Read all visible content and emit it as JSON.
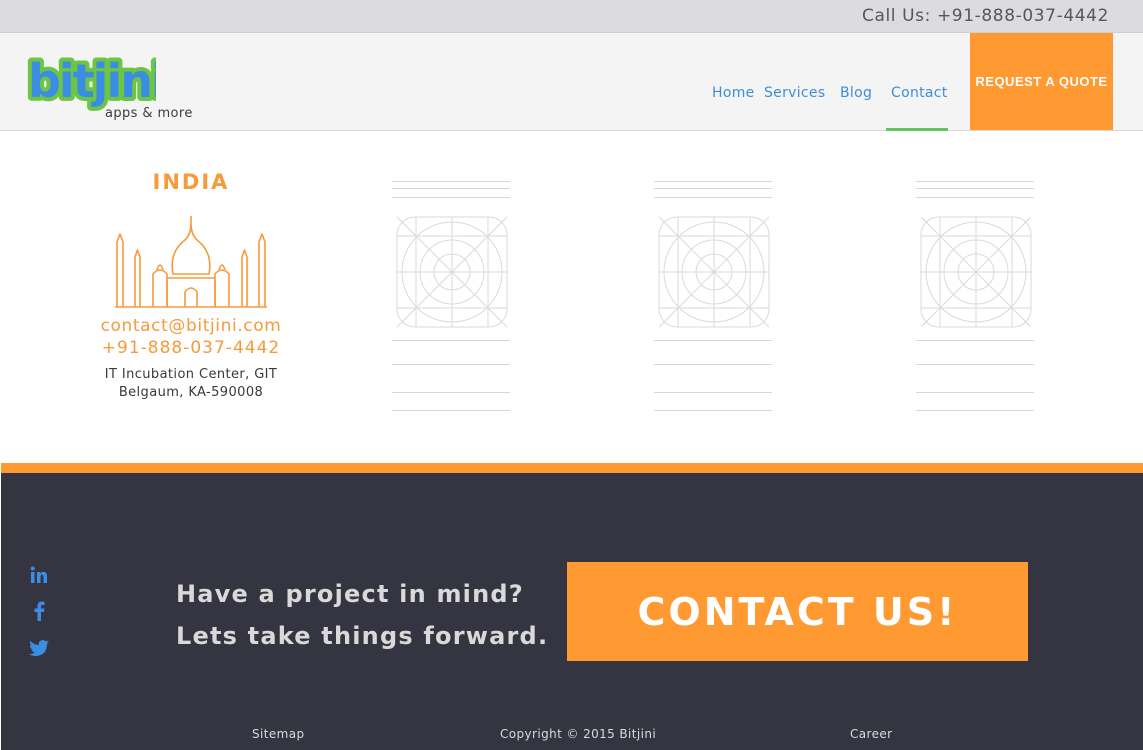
{
  "topbar": {
    "call_text": "Call Us: +91-888-037-4442"
  },
  "brand": {
    "logo_text": "bitjini",
    "tagline": "apps & more",
    "logo_color": "#3b8de3",
    "logo_outline": "#6cc644"
  },
  "nav": {
    "items": [
      {
        "label": "Home"
      },
      {
        "label": "Services"
      },
      {
        "label": "Blog"
      },
      {
        "label": "Contact"
      }
    ],
    "active": "Contact",
    "quote_button": "REQUEST A QUOTE"
  },
  "office": {
    "country": "INDIA",
    "email": "contact@bitjini.com",
    "phone": "+91-888-037-4442",
    "address_line1": "IT Incubation Center, GIT",
    "address_line2": "Belgaum, KA-590008"
  },
  "footer": {
    "cta_line1": "Have a project in mind?",
    "cta_line2": "Lets take things forward.",
    "contact_button": "CONTACT US!",
    "social": [
      "linkedin-icon",
      "facebook-icon",
      "twitter-icon"
    ],
    "links": {
      "sitemap": "Sitemap",
      "copyright": "Copyright © 2015 Bitjini",
      "career": "Career"
    }
  },
  "colors": {
    "accent": "#ff9a32",
    "footer_bg": "#343541",
    "nav_link": "#3c8ed8",
    "active_underline": "#62c462"
  }
}
